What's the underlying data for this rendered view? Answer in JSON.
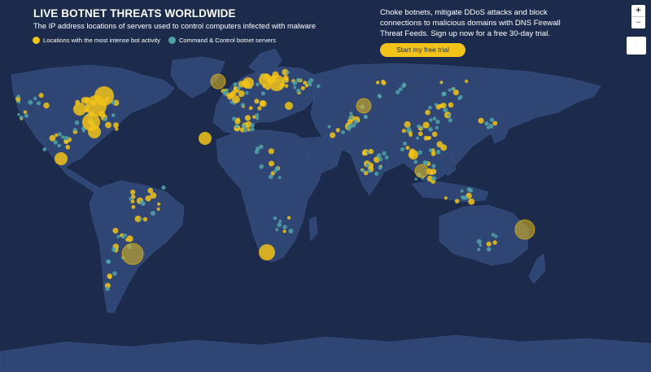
{
  "header": {
    "title": "LIVE BOTNET THREATS WORLDWIDE",
    "subtitle": "The IP address locations of servers used to control computers infected with malware"
  },
  "legend": {
    "items": [
      {
        "label": "Locations with the most intense bot activity",
        "color": "#f2c318"
      },
      {
        "label": "Command & Control botnet servers",
        "color": "#4fa3a7"
      }
    ]
  },
  "promo": {
    "text": "Choke botnets, mitigate DDoS attacks and block connections to malicious domains with DNS Firewall Threat Feeds. Sign up now for a free 30-day trial.",
    "cta_label": "Start my free trial"
  },
  "map_controls": {
    "zoom_in": "+",
    "zoom_out": "−"
  },
  "colors": {
    "ocean": "#1c2b4c",
    "land": "#2f4674",
    "bot_activity": "#f2c318",
    "cnc_servers": "#4fa3a7"
  }
}
